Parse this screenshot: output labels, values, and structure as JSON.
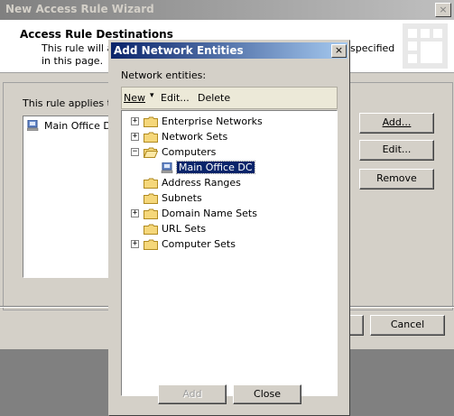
{
  "wizard": {
    "title": "New Access Rule Wizard",
    "heading": "Access Rule Destinations",
    "description": "This rule will ap                                                                     specified in this page.",
    "desc_line1": "This rule will ap",
    "desc_tail": "specified",
    "desc_line2": "in this page.",
    "applies_to": "This rule applies to t",
    "list_item": "Main Office DC",
    "buttons": {
      "add": "Add...",
      "edit": "Edit...",
      "remove": "Remove",
      "cancel": "Cancel"
    }
  },
  "dialog": {
    "title": "Add Network Entities",
    "close_glyph": "×",
    "label": "Network entities:",
    "toolbar": {
      "new": "New",
      "new_arrow": "▾",
      "edit": "Edit...",
      "delete": "Delete"
    },
    "tree": [
      {
        "label": "Enterprise Networks",
        "expander": "+"
      },
      {
        "label": "Network Sets",
        "expander": "+"
      },
      {
        "label": "Computers",
        "expander": "−",
        "expanded": true
      },
      {
        "label": "Main Office DC",
        "selected": true
      },
      {
        "label": "Address Ranges"
      },
      {
        "label": "Subnets"
      },
      {
        "label": "Domain Name Sets",
        "expander": "+"
      },
      {
        "label": "URL Sets"
      },
      {
        "label": "Computer Sets",
        "expander": "+"
      }
    ],
    "buttons": {
      "add": "Add",
      "close": "Close"
    }
  },
  "colors": {
    "titlebar_active": "#0a246a",
    "selection": "#0a246a",
    "face": "#d4d0c8",
    "folder": "#f5d77a"
  }
}
